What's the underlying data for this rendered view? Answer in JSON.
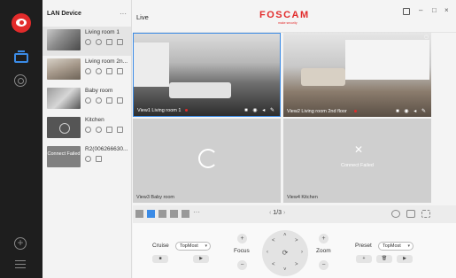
{
  "sidebar": {
    "items": [
      "logo-icon",
      "live-icon",
      "playback-icon",
      "add-icon",
      "menu-icon"
    ]
  },
  "device_list": {
    "title": "LAN Device",
    "more": "···",
    "devices": [
      {
        "name": "Living room 1",
        "status": "online"
      },
      {
        "name": "Living room 2n...",
        "status": "online"
      },
      {
        "name": "Baby room",
        "status": "online"
      },
      {
        "name": "Kitchen",
        "status": "online"
      },
      {
        "name": "R2(006266630...",
        "status": "failed",
        "thumb_text": "Connect Failed"
      }
    ]
  },
  "header": {
    "title": "Live",
    "brand": "FOSCAM",
    "tagline": "make security",
    "window_controls": [
      "lock-icon",
      "–",
      "□",
      "×"
    ]
  },
  "views": [
    {
      "label": "View1 Living room 1",
      "state": "playing"
    },
    {
      "label": "View2 Living room 2nd floor",
      "state": "playing"
    },
    {
      "label": "View3 Baby room",
      "state": "loading"
    },
    {
      "label": "View4 Kitchen",
      "state": "failed",
      "message": "Connect Failed"
    }
  ],
  "toolbar": {
    "more": "···",
    "page": "1/3",
    "prev": "‹",
    "next": "›"
  },
  "controls": {
    "cruise_label": "Cruise",
    "cruise_value": "TopMost",
    "focus_label": "Focus",
    "zoom_label": "Zoom",
    "preset_label": "Preset",
    "preset_value": "TopMost",
    "plus": "+",
    "minus": "−",
    "stop": "■",
    "play": "▶",
    "delete": "🗑"
  },
  "colors": {
    "accent": "#3b8be6",
    "brand": "#e22b2b",
    "rail": "#1e1e1e"
  }
}
